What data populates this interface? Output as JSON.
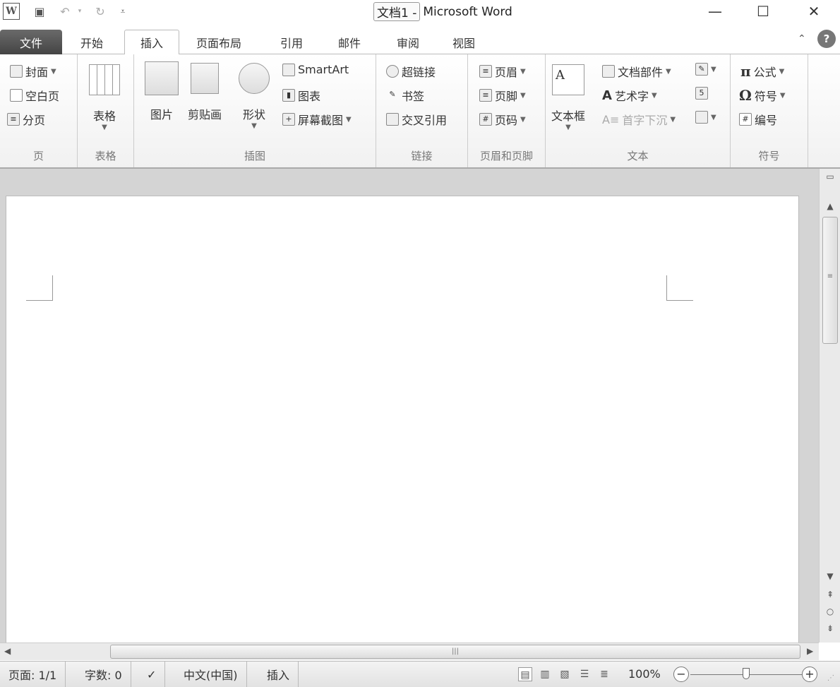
{
  "titlebar": {
    "doc_name": "文档1 -",
    "app_name": "Microsoft Word",
    "quick_access": [
      "word-icon",
      "save-icon",
      "undo-icon",
      "redo-icon",
      "customize-icon"
    ]
  },
  "tabs": [
    "文件",
    "开始",
    "插入",
    "页面布局",
    "引用",
    "邮件",
    "审阅",
    "视图"
  ],
  "ribbon": {
    "page": {
      "label": "页",
      "items": [
        "封面",
        "空白页",
        "分页"
      ]
    },
    "table": {
      "label": "表格",
      "button": "表格"
    },
    "illustrations": {
      "label": "插图",
      "picture": "图片",
      "clipart": "剪贴画",
      "shapes": "形状",
      "smartart": "SmartArt",
      "chart": "图表",
      "screenshot": "屏幕截图"
    },
    "links": {
      "label": "链接",
      "items": [
        "超链接",
        "书签",
        "交叉引用"
      ]
    },
    "header_footer": {
      "label": "页眉和页脚",
      "items": [
        "页眉",
        "页脚",
        "页码"
      ]
    },
    "text": {
      "label": "文本",
      "textbox": "文本框",
      "quickparts": "文档部件",
      "wordart": "艺术字",
      "dropcap": "首字下沉"
    },
    "symbols": {
      "label": "符号",
      "equation": "公式",
      "symbol": "符号",
      "number": "编号",
      "pi": "π",
      "omega": "Ω"
    }
  },
  "status": {
    "page": "页面: 1/1",
    "words": "字数: 0",
    "language": "中文(中国)",
    "mode": "插入",
    "zoom": "100%",
    "zoom_fraction": 0.5
  },
  "colors": {
    "file_tab": "#555555",
    "workarea": "#d4d4d4"
  }
}
